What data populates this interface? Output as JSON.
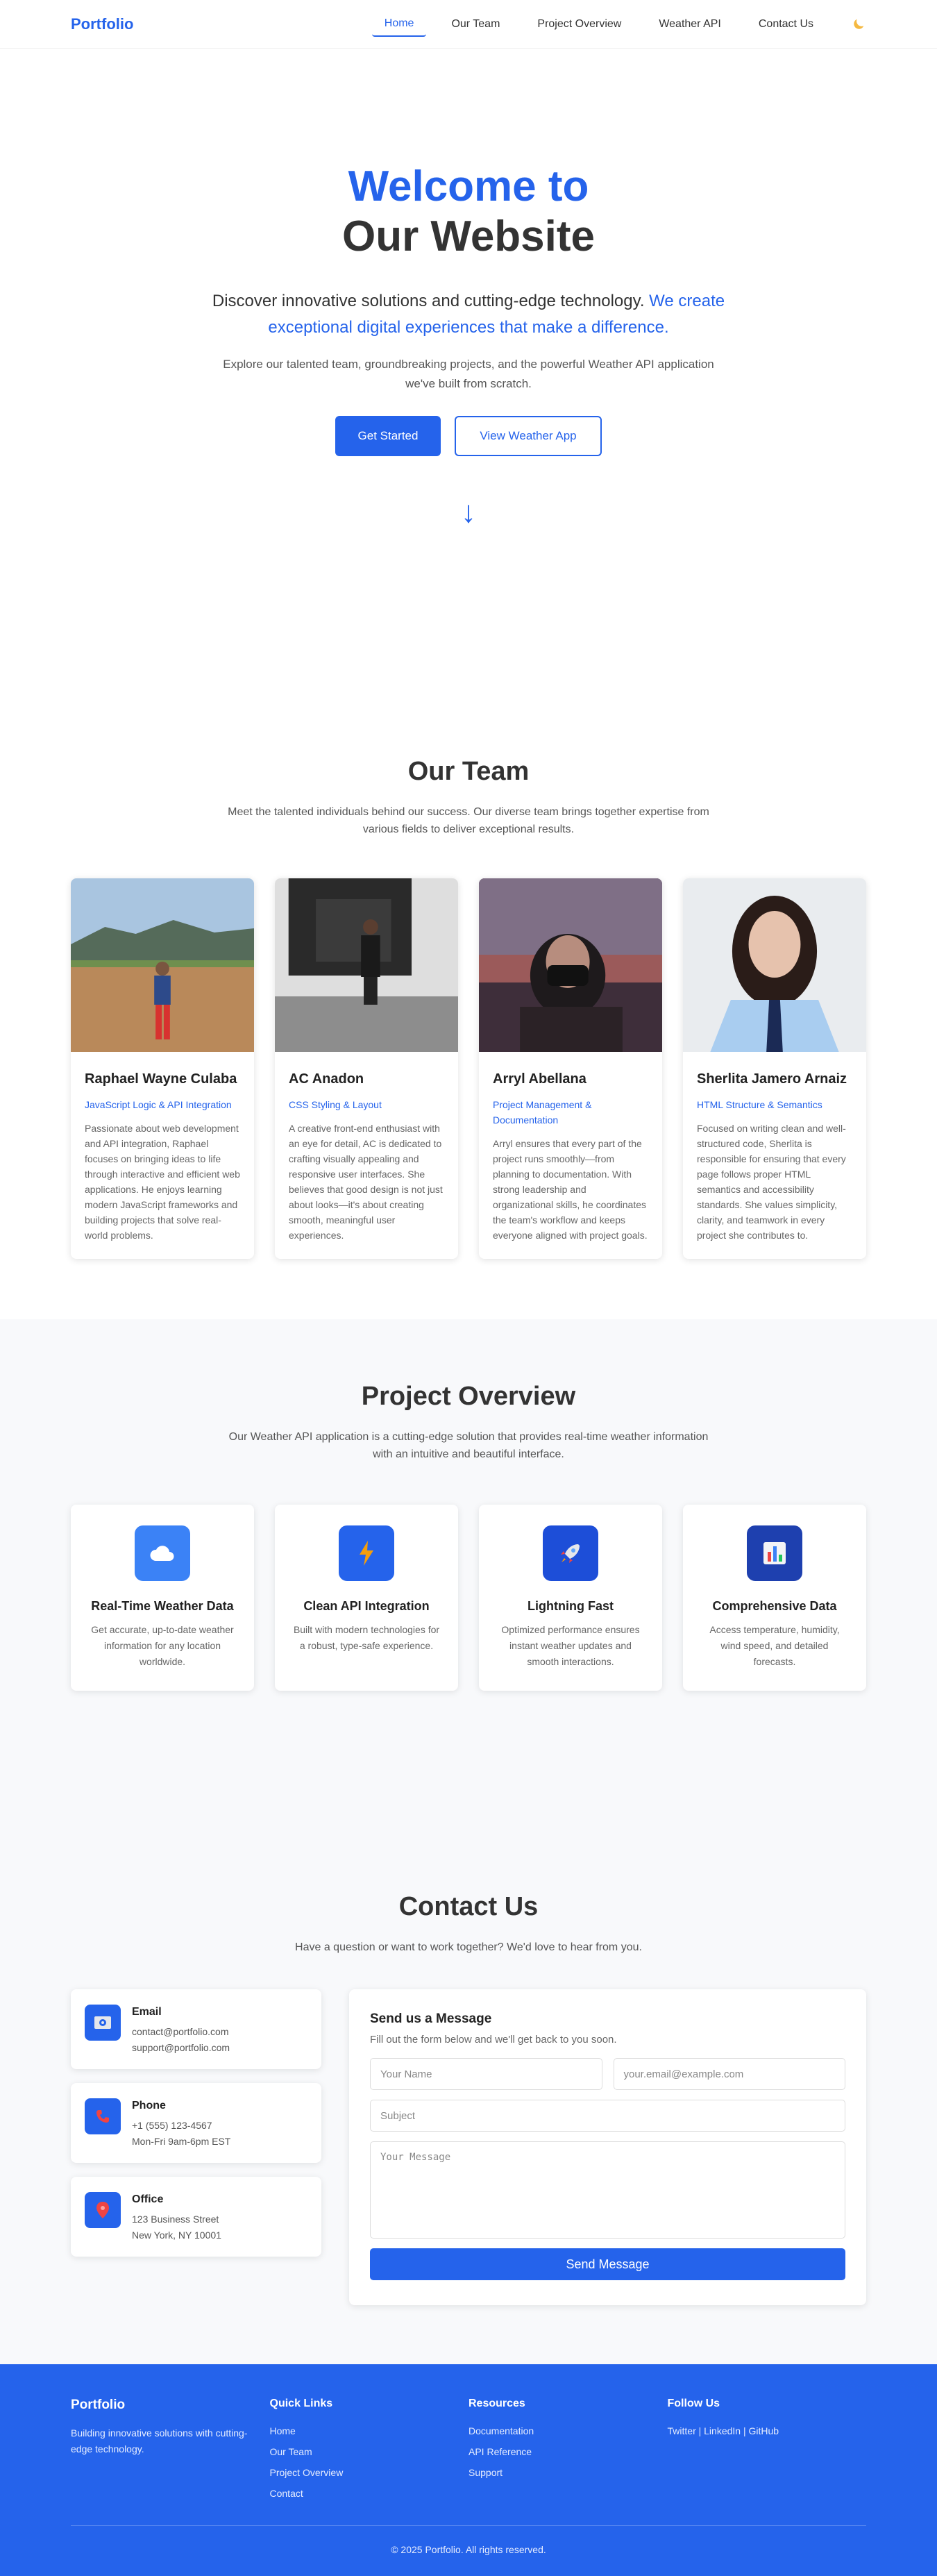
{
  "header": {
    "brand": "Portfolio",
    "nav": [
      "Home",
      "Our Team",
      "Project Overview",
      "Weather API",
      "Contact Us"
    ],
    "active_index": 0,
    "theme_icon": "moon-icon"
  },
  "hero": {
    "title_line1": "Welcome to",
    "title_line2": "Our Website",
    "lead_dark": "Discover innovative solutions and cutting-edge technology.",
    "lead_blue": "We create exceptional digital experiences that make a difference.",
    "sub": "Explore our talented team, groundbreaking projects, and the powerful Weather API application we've built from scratch.",
    "primary_button": "Get Started",
    "secondary_button": "View Weather App",
    "arrow": "↓"
  },
  "team": {
    "title": "Our Team",
    "desc": "Meet the talented individuals behind our success. Our diverse team brings together expertise from various fields to deliver exceptional results.",
    "members": [
      {
        "name": "Raphael Wayne Culaba",
        "role": "JavaScript Logic & API Integration",
        "bio": "Passionate about web development and API integration, Raphael focuses on bringing ideas to life through interactive and efficient web applications. He enjoys learning modern JavaScript frameworks and building projects that solve real-world problems."
      },
      {
        "name": "AC Anadon",
        "role": "CSS Styling & Layout",
        "bio": "A creative front-end enthusiast with an eye for detail, AC is dedicated to crafting visually appealing and responsive user interfaces. She believes that good design is not just about looks—it's about creating smooth, meaningful user experiences."
      },
      {
        "name": "Arryl Abellana",
        "role": "Project Management & Documentation",
        "bio": "Arryl ensures that every part of the project runs smoothly—from planning to documentation. With strong leadership and organizational skills, he coordinates the team's workflow and keeps everyone aligned with project goals."
      },
      {
        "name": "Sherlita Jamero Arnaiz",
        "role": "HTML Structure & Semantics",
        "bio": "Focused on writing clean and well-structured code, Sherlita is responsible for ensuring that every page follows proper HTML semantics and accessibility standards. She values simplicity, clarity, and teamwork in every project she contributes to."
      }
    ]
  },
  "project": {
    "title": "Project Overview",
    "desc": "Our Weather API application is a cutting-edge solution that provides real-time weather information with an intuitive and beautiful interface.",
    "features": [
      {
        "icon": "cloud-icon",
        "title": "Real-Time Weather Data",
        "desc": "Get accurate, up-to-date weather information for any location worldwide."
      },
      {
        "icon": "lightning-icon",
        "title": "Clean API Integration",
        "desc": "Built with modern technologies for a robust, type-safe experience."
      },
      {
        "icon": "rocket-icon",
        "title": "Lightning Fast",
        "desc": "Optimized performance ensures instant weather updates and smooth interactions."
      },
      {
        "icon": "bar-chart-icon",
        "title": "Comprehensive Data",
        "desc": "Access temperature, humidity, wind speed, and detailed forecasts."
      }
    ]
  },
  "contact": {
    "title": "Contact Us",
    "desc": "Have a question or want to work together? We'd love to hear from you.",
    "cards": [
      {
        "icon": "email-icon",
        "title": "Email",
        "lines": [
          "contact@portfolio.com",
          "support@portfolio.com"
        ]
      },
      {
        "icon": "phone-icon",
        "title": "Phone",
        "lines": [
          "+1 (555) 123-4567",
          "Mon-Fri 9am-6pm EST"
        ]
      },
      {
        "icon": "location-pin-icon",
        "title": "Office",
        "lines": [
          "123 Business Street",
          "New York, NY 10001"
        ]
      }
    ],
    "form": {
      "title": "Send us a Message",
      "sub": "Fill out the form below and we'll get back to you soon.",
      "name_placeholder": "Your Name",
      "email_placeholder": "your.email@example.com",
      "subject_placeholder": "Subject",
      "message_placeholder": "Your Message",
      "submit": "Send Message"
    }
  },
  "footer": {
    "brand": "Portfolio",
    "tagline": "Building innovative solutions with cutting-edge technology.",
    "quick_links_title": "Quick Links",
    "quick_links": [
      "Home",
      "Our Team",
      "Project Overview",
      "Contact"
    ],
    "resources_title": "Resources",
    "resources": [
      "Documentation",
      "API Reference",
      "Support"
    ],
    "follow_title": "Follow Us",
    "social": "Twitter | LinkedIn | GitHub",
    "copyright": "© 2025 Portfolio. All rights reserved."
  },
  "colors": {
    "accent": "#2563eb",
    "text": "#333333",
    "section_bg": "#f8f9fb"
  }
}
